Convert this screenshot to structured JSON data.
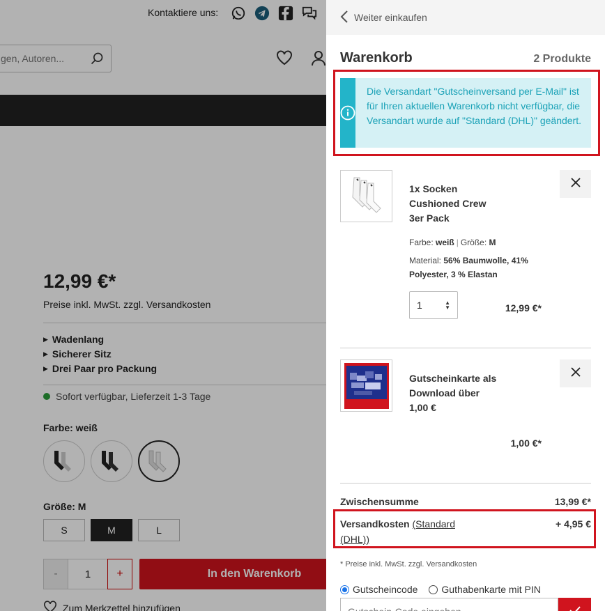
{
  "background": {
    "contact_label": "Kontaktiere uns:",
    "search": {
      "placeholder": "gen, Autoren..."
    },
    "product": {
      "price": "12,99 €*",
      "price_note": "Preise inkl. MwSt. zzgl. Versandkosten",
      "features": [
        "Wadenlang",
        "Sicherer Sitz",
        "Drei Paar pro Packung"
      ],
      "stock": "Sofort verfügbar, Lieferzeit 1-3 Tage",
      "color_label": "Farbe: weiß",
      "size_label": "Größe: M",
      "sizes": [
        "S",
        "M",
        "L"
      ],
      "quantity": "1",
      "qty_minus": "-",
      "qty_plus": "+",
      "add_to_cart": "In den Warenkorb",
      "wishlist": "Zum Merkzettel hinzufügen"
    }
  },
  "cart": {
    "back_label": "Weiter einkaufen",
    "title": "Warenkorb",
    "count": "2 Produkte",
    "notice": "Die Versandart \"Gutscheinversand per E-Mail\" ist für Ihren aktuellen Warenkorb nicht verfügbar, die Versandart wurde auf \"Standard (DHL)\" geändert.",
    "items": [
      {
        "name": "1x Socken Cushioned Crew 3er Pack",
        "attr_color_label": "Farbe:",
        "attr_color": "weiß",
        "attr_size_label": "Größe:",
        "attr_size": "M",
        "material_label": "Material:",
        "material": "56% Baumwolle, 41% Polyester, 3 % Elastan",
        "quantity": "1",
        "price": "12,99 €*"
      },
      {
        "name": "Gutscheinkarte als Download über 1,00 €",
        "price": "1,00 €*"
      }
    ],
    "subtotal_label": "Zwischensumme",
    "subtotal": "13,99 €*",
    "shipping_label": "Versandkosten",
    "shipping_method": "(Standard (DHL))",
    "shipping_cost": "+ 4,95 €",
    "footnote": "* Preise inkl. MwSt. zzgl. Versandkosten",
    "voucher_options": [
      "Gutscheincode",
      "Guthabenkarte mit PIN"
    ],
    "voucher_placeholder": "Gutschein-Code eingeben"
  },
  "colors": {
    "accent_red": "#d0141e",
    "info_bg": "#d5f1f5",
    "info_accent": "#23b4c9",
    "info_text": "#1ba2b7"
  }
}
